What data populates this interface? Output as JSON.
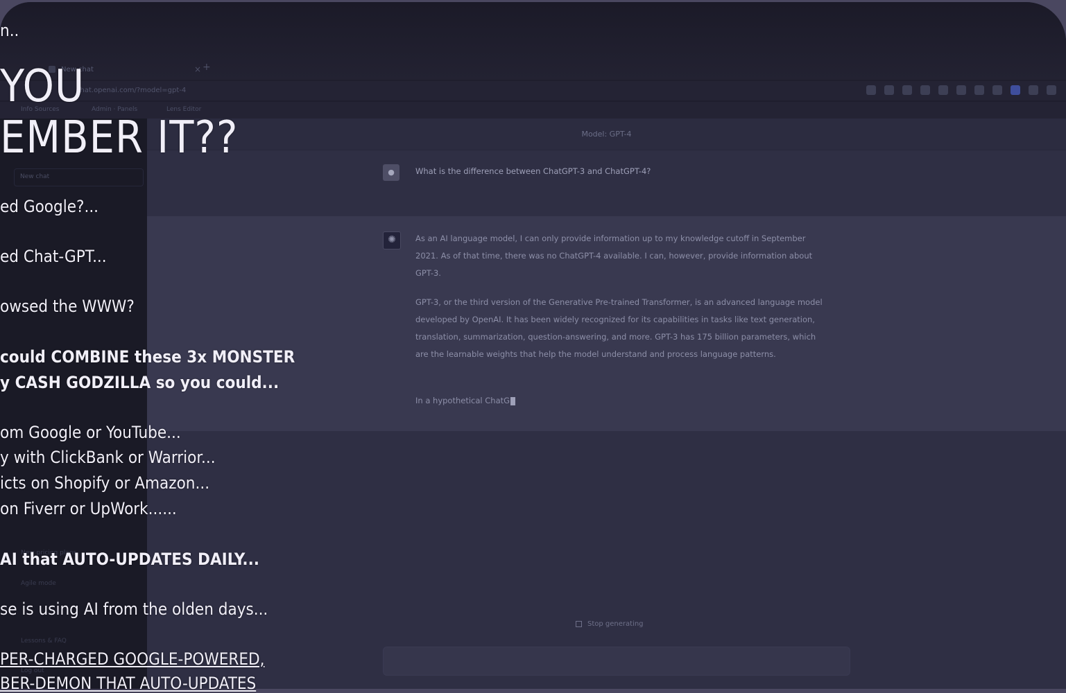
{
  "browser": {
    "tab_title": "New chat",
    "tab_close": "×",
    "new_tab": "+",
    "url": "chat.openai.com/?model=gpt-4",
    "bookmarks": [
      "Info Sources",
      "Admin · Panels",
      "Lens Editor"
    ]
  },
  "sidebar": {
    "new_chat_label": "New chat",
    "items": [
      "New pricing plans",
      "Agile mode",
      "Lessons & FAQ",
      "Log out"
    ]
  },
  "chat": {
    "model_label": "Model: GPT-4",
    "user_message": "What is the difference between ChatGPT-3 and ChatGPT-4?",
    "assistant_p1": "As an AI language model, I can only provide information up to my knowledge cutoff in September 2021. As of that time, there was no ChatGPT-4 available. I can, however, provide information about GPT-3.",
    "assistant_p2": "GPT-3, or the third version of the Generative Pre-trained Transformer, is an advanced language model developed by OpenAI. It has been widely recognized for its capabilities in tasks like text generation, translation, summarization, question-answering, and more. GPT-3 has 175 billion parameters, which are the learnable weights that help the model understand and process language patterns.",
    "assistant_p3": "In a hypothetical ChatG",
    "stop_label": "Stop generating"
  },
  "overlay": {
    "line0": "n..",
    "line1": "YOU",
    "line2": "EMBER IT??",
    "line3": "ed Google?...",
    "line4": "ed Chat-GPT...",
    "line5": "owsed the WWW?",
    "line6": "could COMBINE these 3x MONSTER",
    "line7": "y CASH GODZILLA so you could...",
    "line8": "om Google or YouTube...",
    "line9": "y with ClickBank or Warrior...",
    "line10": "icts on Shopify or Amazon...",
    "line11": " on Fiverr or UpWork......",
    "line12": "AI that AUTO-UPDATES DAILY...",
    "line13": "se is using AI from the olden days...",
    "line14": "PER-CHARGED GOOGLE-POWERED,",
    "line15": "BER-DEMON THAT AUTO-UPDATES"
  }
}
